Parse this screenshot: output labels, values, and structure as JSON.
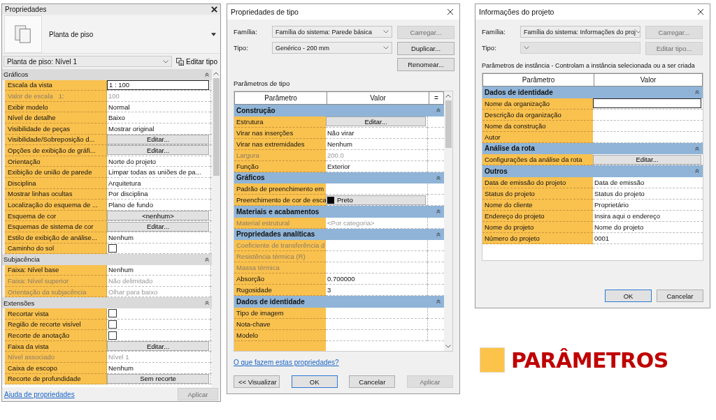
{
  "properties_panel": {
    "title": "Propriedades",
    "type_name": "Planta de piso",
    "instance_select": "Planta de piso: Nível 1",
    "edit_type": "Editar tipo",
    "sections": [
      {
        "title": "Gráficos",
        "rows": [
          {
            "name": "Escala da vista",
            "value": "1 : 100",
            "kind": "input",
            "disabled": false
          },
          {
            "name": "Valor de escala   1:",
            "value": "100",
            "kind": "text",
            "disabled": true
          },
          {
            "name": "Exibir modelo",
            "value": "Normal",
            "kind": "text",
            "disabled": false
          },
          {
            "name": "Nível de detalhe",
            "value": "Baixo",
            "kind": "text",
            "disabled": false
          },
          {
            "name": "Visibilidade de peças",
            "value": "Mostrar original",
            "kind": "text",
            "disabled": false
          },
          {
            "name": "Visibilidade/Sobreposição d...",
            "value": "Editar...",
            "kind": "button",
            "disabled": false
          },
          {
            "name": "Opções de exibição de gráfi...",
            "value": "Editar...",
            "kind": "button",
            "disabled": false
          },
          {
            "name": "Orientação",
            "value": "Norte do projeto",
            "kind": "text",
            "disabled": false
          },
          {
            "name": "Exibição de união de parede",
            "value": "Limpar todas as uniões de pa...",
            "kind": "text",
            "disabled": false
          },
          {
            "name": "Disciplina",
            "value": "Arquitetura",
            "kind": "text",
            "disabled": false
          },
          {
            "name": "Mostrar linhas ocultas",
            "value": "Por disciplina",
            "kind": "text",
            "disabled": false
          },
          {
            "name": "Localização do esquema de ...",
            "value": "Plano de fundo",
            "kind": "text",
            "disabled": false
          },
          {
            "name": "Esquema de cor",
            "value": "<nenhum>",
            "kind": "button",
            "disabled": false
          },
          {
            "name": "Esquemas de sistema de cor",
            "value": "Editar...",
            "kind": "button",
            "disabled": false
          },
          {
            "name": "Estilo de exibição de análise...",
            "value": "Nenhum",
            "kind": "text",
            "disabled": false
          },
          {
            "name": "Caminho do sol",
            "kind": "checkbox",
            "checked": false,
            "disabled": false
          }
        ]
      },
      {
        "title": "Subjacência",
        "rows": [
          {
            "name": "Faixa: Nível base",
            "value": "Nenhum",
            "kind": "text",
            "disabled": false
          },
          {
            "name": "Faixa: Nível superior",
            "value": "Não delimitado",
            "kind": "text",
            "disabled": true
          },
          {
            "name": "Orientação da subjacência",
            "value": "Olhar para baixo",
            "kind": "text",
            "disabled": true
          }
        ]
      },
      {
        "title": "Extensões",
        "rows": [
          {
            "name": "Recortar vista",
            "kind": "checkbox",
            "checked": false,
            "disabled": false
          },
          {
            "name": "Região de recorte visível",
            "kind": "checkbox",
            "checked": false,
            "disabled": false
          },
          {
            "name": "Recorte de anotação",
            "kind": "checkbox",
            "checked": false,
            "disabled": false
          },
          {
            "name": "Faixa da vista",
            "value": "Editar...",
            "kind": "button",
            "disabled": false
          },
          {
            "name": "Nível associado",
            "value": "Nível 1",
            "kind": "text",
            "disabled": true
          },
          {
            "name": "Caixa de escopo",
            "value": "Nenhum",
            "kind": "text",
            "disabled": false
          },
          {
            "name": "Recorte de profundidade",
            "value": "Sem recorte",
            "kind": "button",
            "disabled": false
          }
        ]
      }
    ],
    "help_link": "Ajuda de propriedades",
    "apply_button": {
      "label": "Aplicar",
      "disabled": true
    }
  },
  "type_properties": {
    "title": "Propriedades de tipo",
    "fields": [
      {
        "label": "Família:",
        "value": "Família do sistema: Parede básica",
        "disabled": false
      },
      {
        "label": "Tipo:",
        "value": "Genérico - 200 mm",
        "disabled": false
      }
    ],
    "side_buttons": [
      {
        "label": "Carregar...",
        "disabled": true
      },
      {
        "label": "Duplicar...",
        "disabled": false
      },
      {
        "label": "Renomear...",
        "disabled": false
      }
    ],
    "caption": "Parâmetros de tipo",
    "columns": [
      "Parâmetro",
      "Valor",
      "="
    ],
    "sections": [
      {
        "title": "Construção",
        "rows": [
          {
            "name": "Estrutura",
            "value": "Editar...",
            "kind": "button",
            "disabled": false
          },
          {
            "name": "Virar nas inserções",
            "value": "Não virar",
            "kind": "text",
            "disabled": false
          },
          {
            "name": "Virar nas extremidades",
            "value": "Nenhum",
            "kind": "text",
            "disabled": false
          },
          {
            "name": "Largura",
            "value": "200.0",
            "kind": "text",
            "disabled": true
          },
          {
            "name": "Função",
            "value": "Exterior",
            "kind": "text",
            "disabled": false
          }
        ]
      },
      {
        "title": "Gráficos",
        "rows": [
          {
            "name": "Padrão de preenchimento em",
            "kind": "text",
            "disabled": false
          },
          {
            "name": "Preenchimento de cor de esca",
            "value": "Preto",
            "kind": "swatch",
            "color": "#000000",
            "disabled": false
          }
        ]
      },
      {
        "title": "Materiais e acabamentos",
        "rows": [
          {
            "name": "Material estrutural",
            "value": "<Por categoria>",
            "kind": "text",
            "disabled": true
          }
        ]
      },
      {
        "title": "Propriedades analíticas",
        "rows": [
          {
            "name": "Coeficiente de transferência d",
            "kind": "text",
            "disabled": true
          },
          {
            "name": "Resistência térmica (R)",
            "kind": "text",
            "disabled": true
          },
          {
            "name": "Massa térmica",
            "kind": "text",
            "disabled": true
          },
          {
            "name": "Absorção",
            "value": "0.700000",
            "kind": "text",
            "disabled": false
          },
          {
            "name": "Rugosidade",
            "value": "3",
            "kind": "text",
            "disabled": false
          }
        ]
      },
      {
        "title": "Dados de identidade",
        "rows": [
          {
            "name": "Tipo de imagem",
            "kind": "text",
            "disabled": false
          },
          {
            "name": "Nota-chave",
            "kind": "text",
            "disabled": false
          },
          {
            "name": "Modelo",
            "kind": "text",
            "disabled": false
          }
        ]
      }
    ],
    "help_link": "O que fazem estas propriedades?",
    "footer_buttons": [
      {
        "label": "<< Visualizar",
        "disabled": false,
        "default": false
      },
      {
        "label": "OK",
        "disabled": false,
        "default": true
      },
      {
        "label": "Cancelar",
        "disabled": false,
        "default": false
      },
      {
        "label": "Aplicar",
        "disabled": true,
        "default": false
      }
    ]
  },
  "project_info": {
    "title": "Informações do projeto",
    "fields": [
      {
        "label": "Família:",
        "value": "Família do sistema: Informações do proj",
        "disabled": false
      },
      {
        "label": "Tipo:",
        "disabled": true
      }
    ],
    "side_buttons": [
      {
        "label": "Carregar...",
        "disabled": true
      },
      {
        "label": "Editar tipo...",
        "disabled": true
      }
    ],
    "caption": "Parâmetros de instância - Controlam a instância selecionada ou a ser criada",
    "columns": [
      "Parâmetro",
      "Valor"
    ],
    "sections": [
      {
        "title": "Dados de identidade",
        "rows": [
          {
            "name": "Nome da organização",
            "kind": "input",
            "disabled": false
          },
          {
            "name": "Descrição da organização",
            "kind": "text",
            "disabled": false
          },
          {
            "name": "Nome da construção",
            "kind": "text",
            "disabled": false
          },
          {
            "name": "Autor",
            "kind": "text",
            "disabled": false
          }
        ]
      },
      {
        "title": "Análise da rota",
        "rows": [
          {
            "name": "Configurações da análise da rota",
            "value": "Editar...",
            "kind": "button",
            "disabled": false
          }
        ]
      },
      {
        "title": "Outros",
        "rows": [
          {
            "name": "Data de emissão do projeto",
            "value": "Data de emissão",
            "kind": "text",
            "disabled": false
          },
          {
            "name": "Status do projeto",
            "value": "Status do projeto",
            "kind": "text",
            "disabled": false
          },
          {
            "name": "Nome do cliente",
            "value": "Proprietário",
            "kind": "text",
            "disabled": false
          },
          {
            "name": "Endereço do projeto",
            "value": "Insira aqui o endereço",
            "kind": "text",
            "disabled": false
          },
          {
            "name": "Nome do projeto",
            "value": "Nome do projeto",
            "kind": "text",
            "disabled": false
          },
          {
            "name": "Número do projeto",
            "value": "0001",
            "kind": "text",
            "disabled": false
          }
        ]
      }
    ],
    "footer_buttons": [
      {
        "label": "OK",
        "disabled": false,
        "default": true
      },
      {
        "label": "Cancelar",
        "disabled": false,
        "default": false
      }
    ]
  },
  "legend": {
    "label": "PARÂMETROS"
  }
}
